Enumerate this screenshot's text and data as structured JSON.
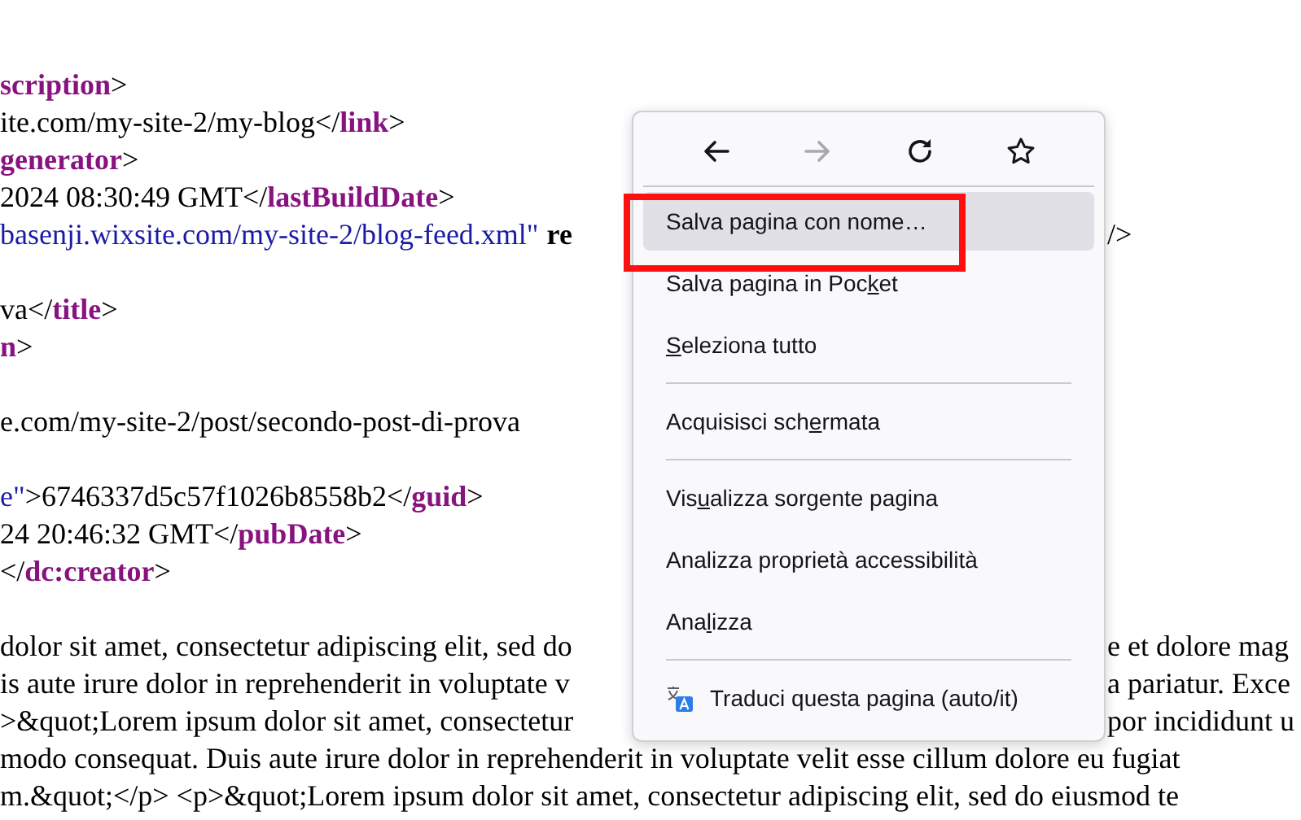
{
  "page": {
    "lines": [
      {
        "kind": "code",
        "left": [
          {
            "kind": "tag",
            "text": "scription"
          },
          {
            "kind": "text",
            "text": ">"
          }
        ]
      },
      {
        "left": [
          {
            "kind": "text",
            "text": "ite.com/my-site-2/my-blog</"
          },
          {
            "kind": "tag",
            "text": "link"
          },
          {
            "kind": "text",
            "text": ">"
          }
        ]
      },
      {
        "left": [
          {
            "kind": "tag",
            "text": "generator"
          },
          {
            "kind": "text",
            "text": ">"
          }
        ]
      },
      {
        "left": [
          {
            "kind": "text",
            "text": "2024 08:30:49 GMT</"
          },
          {
            "kind": "tag",
            "text": "lastBuildDate"
          },
          {
            "kind": "text",
            "text": ">"
          }
        ]
      },
      {
        "left": [
          {
            "kind": "link",
            "text": "basenji.wixsite.com/my-site-2/blog-feed.xml\""
          },
          {
            "kind": "bold",
            "text": "re"
          }
        ],
        "right": [
          {
            "kind": "text",
            "text": "/>"
          }
        ]
      },
      {
        "kind": "blank"
      },
      {
        "left": [
          {
            "kind": "text",
            "text": "va</"
          },
          {
            "kind": "tag",
            "text": "title"
          },
          {
            "kind": "text",
            "text": ">"
          }
        ]
      },
      {
        "left": [
          {
            "kind": "tag",
            "text": "n"
          },
          {
            "kind": "text",
            "text": ">"
          }
        ]
      },
      {
        "kind": "blank"
      },
      {
        "left": [
          {
            "kind": "text",
            "text": "e.com/my-site-2/post/secondo-post-di-prova"
          }
        ]
      },
      {
        "kind": "blank"
      },
      {
        "left": [
          {
            "kind": "link",
            "text": "e\""
          },
          {
            "kind": "text",
            "text": ">6746337d5c57f1026b8558b2</"
          },
          {
            "kind": "tag",
            "text": "guid"
          },
          {
            "kind": "text",
            "text": ">"
          }
        ]
      },
      {
        "left": [
          {
            "kind": "text",
            "text": "24 20:46:32 GMT</"
          },
          {
            "kind": "tag",
            "text": "pubDate"
          },
          {
            "kind": "text",
            "text": ">"
          }
        ]
      },
      {
        "left": [
          {
            "kind": "text",
            "text": "</"
          },
          {
            "kind": "tag",
            "text": "dc:creator"
          },
          {
            "kind": "text",
            "text": ">"
          }
        ]
      },
      {
        "kind": "blank"
      },
      {
        "left": [
          {
            "kind": "text",
            "text": "dolor sit amet, consectetur adipiscing elit, sed do"
          }
        ],
        "right": [
          {
            "kind": "text",
            "text": "e et dolore mag"
          }
        ]
      },
      {
        "left": [
          {
            "kind": "text",
            "text": "is aute irure dolor in reprehenderit in voluptate v"
          }
        ],
        "right": [
          {
            "kind": "text",
            "text": "a pariatur. Exce"
          }
        ]
      },
      {
        "left": [
          {
            "kind": "text",
            "text": ">&quot;Lorem ipsum dolor sit amet, consectetur"
          }
        ],
        "right": [
          {
            "kind": "text",
            "text": "por incididunt u"
          }
        ]
      },
      {
        "left": [
          {
            "kind": "text",
            "text": "modo consequat. Duis aute irure dolor in reprehenderit in voluptate velit esse cillum dolore eu fugiat"
          }
        ]
      },
      {
        "left": [
          {
            "kind": "text",
            "text": "m.&quot;</p> <p>&quot;Lorem ipsum dolor sit amet, consectetur adipiscing elit, sed do eiusmod te"
          }
        ]
      }
    ]
  },
  "context_menu": {
    "nav": [
      {
        "kind": "back",
        "disabled": false
      },
      {
        "kind": "forward",
        "disabled": true
      },
      {
        "kind": "reload",
        "disabled": false
      },
      {
        "kind": "bookmark",
        "disabled": false
      }
    ],
    "items": [
      {
        "kind": "item",
        "before": "Salva pagina con nome…",
        "selected": true,
        "annotated": true
      },
      {
        "kind": "item",
        "before": "Salva pagina in Poc",
        "key": "k",
        "after": "et",
        "selected": false
      },
      {
        "kind": "item",
        "key": "S",
        "after": "eleziona tutto",
        "selected": false
      },
      {
        "kind": "separator"
      },
      {
        "kind": "item",
        "before": "Acquisisci sch",
        "key": "e",
        "after": "rmata",
        "selected": false
      },
      {
        "kind": "separator"
      },
      {
        "kind": "item",
        "before": "Vis",
        "key": "u",
        "after": "alizza sorgente pagina",
        "selected": false
      },
      {
        "kind": "item",
        "before": "Analizza proprietà accessibilità",
        "selected": false
      },
      {
        "kind": "item",
        "before": "Ana",
        "key": "l",
        "after": "izza",
        "selected": false
      },
      {
        "kind": "separator"
      },
      {
        "kind": "translate",
        "before": "Traduci questa pagina (auto/it)",
        "selected": false
      }
    ]
  }
}
